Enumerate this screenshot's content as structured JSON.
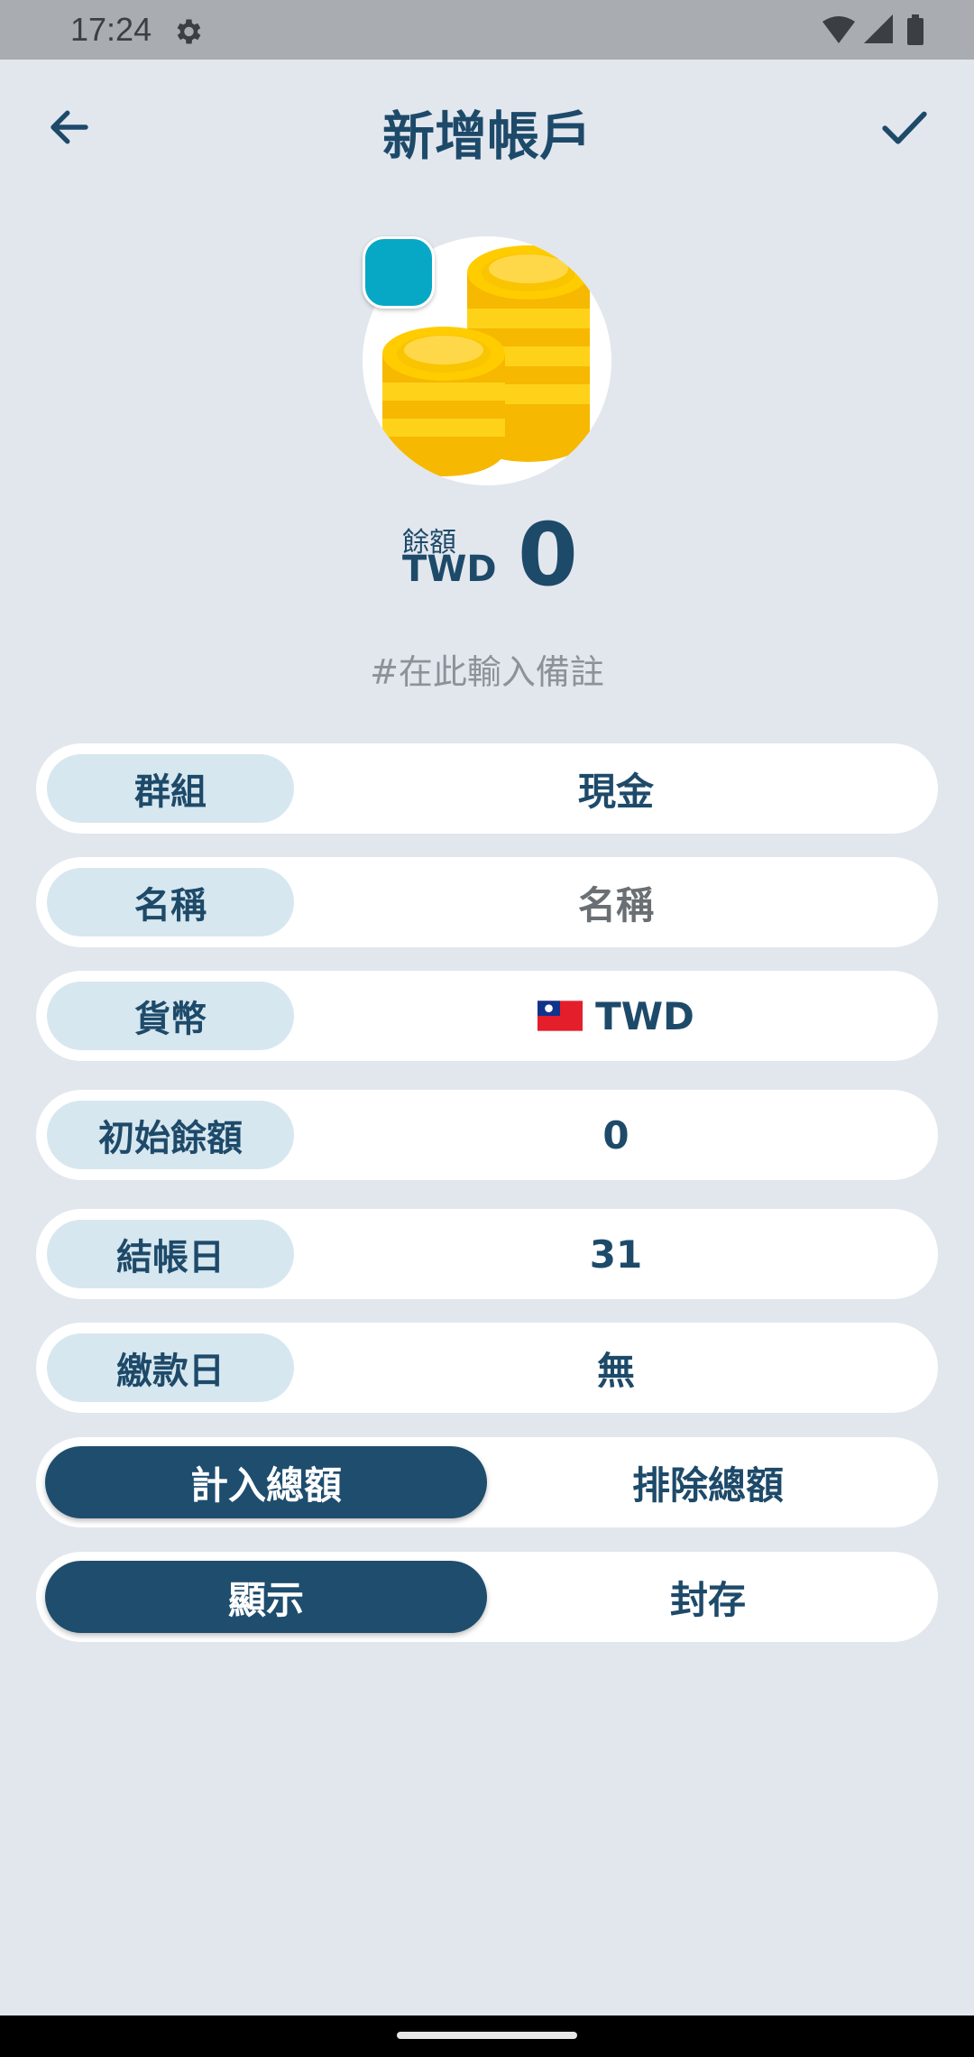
{
  "status_bar": {
    "time": "17:24"
  },
  "header": {
    "title": "新增帳戶",
    "back_icon": "arrow-left-icon",
    "confirm_icon": "check-icon"
  },
  "avatar": {
    "icon": "coins-icon",
    "color": "#07a8c5"
  },
  "balance": {
    "label": "餘額",
    "currency": "TWD",
    "value": "0"
  },
  "note": {
    "placeholder": "#在此輸入備註"
  },
  "fields": [
    {
      "label": "群組",
      "value": "現金"
    },
    {
      "label": "名稱",
      "value": "名稱"
    },
    {
      "label": "貨幣",
      "value": "TWD",
      "icon": "taiwan-flag-icon"
    },
    {
      "label": "初始餘額",
      "value": "0"
    },
    {
      "label": "結帳日",
      "value": "31"
    },
    {
      "label": "繳款日",
      "value": "無"
    }
  ],
  "toggles": [
    {
      "active": "計入總額",
      "inactive": "排除總額"
    },
    {
      "active": "顯示",
      "inactive": "封存"
    }
  ],
  "colors": {
    "primary": "#1e4a6a",
    "active_toggle": "#1e4d6e",
    "label_pill": "#d7e7ef",
    "background": "#e2e7ee"
  }
}
